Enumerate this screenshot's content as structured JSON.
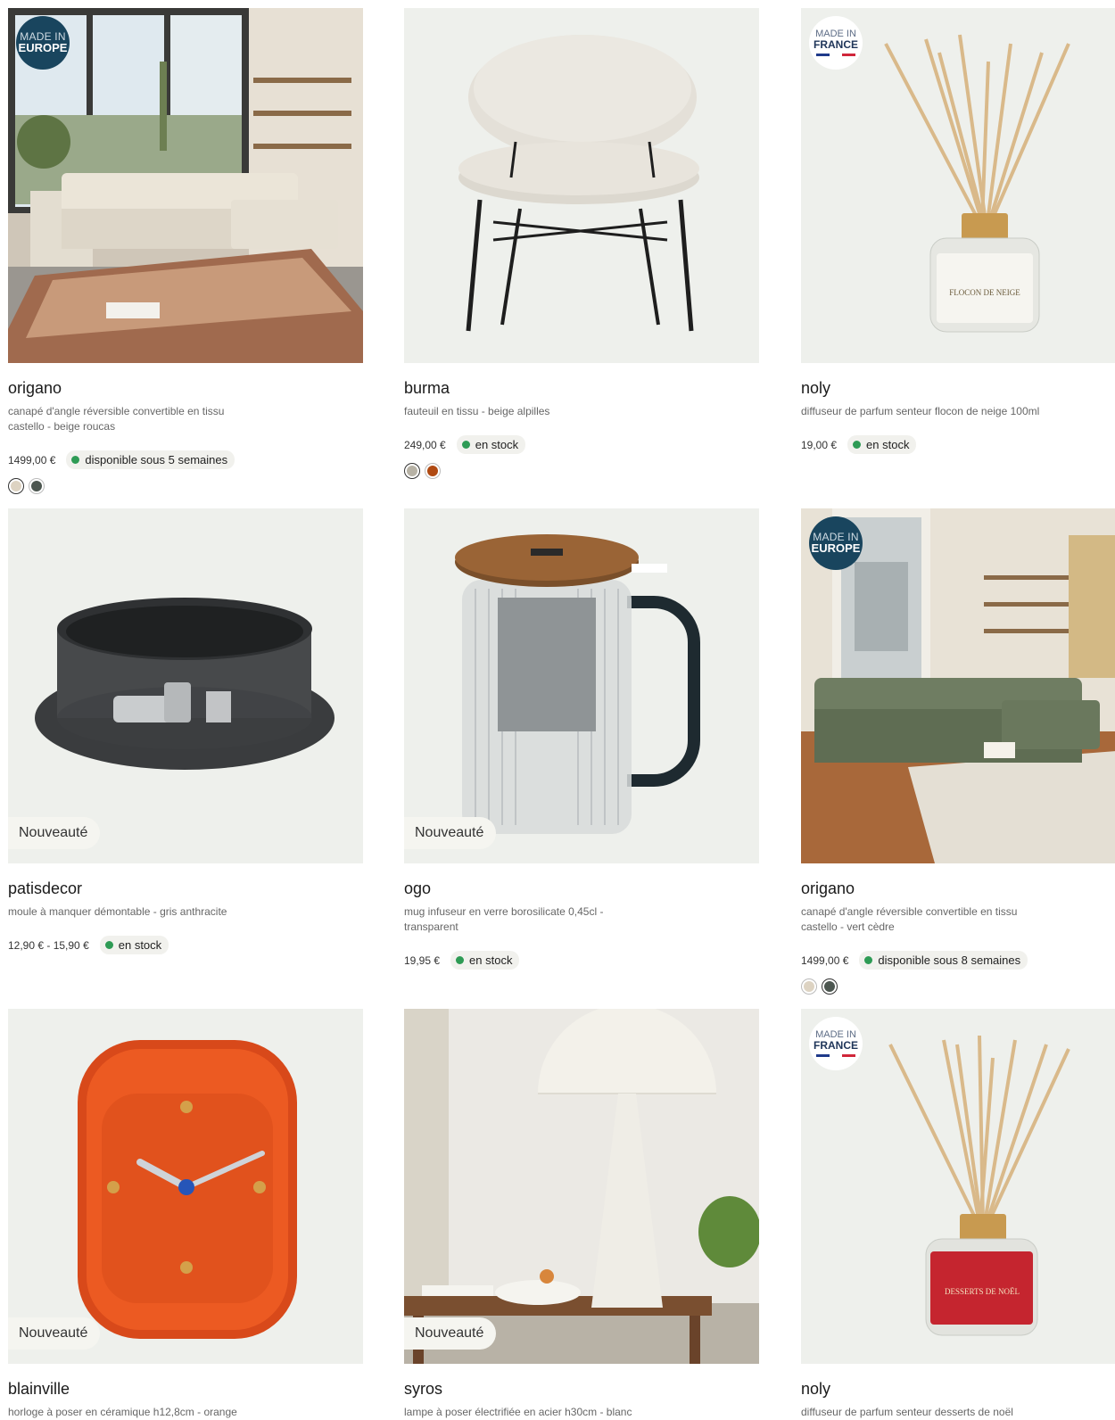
{
  "products": [
    {
      "title": "origano",
      "desc": "canapé d'angle réversible convertible en tissu castello - beige roucas",
      "price": "1499,00 €",
      "stock": "disponible sous 5 semaines",
      "badge": "MADE IN EUROPE",
      "badge_l1": "MADE IN",
      "badge_l2": "EUROPE",
      "swatches": [
        "#ddd3c2",
        "#4c5650"
      ],
      "icon": "sofa-beige-photo"
    },
    {
      "title": "burma",
      "desc": "fauteuil en tissu - beige alpilles",
      "price": "249,00 €",
      "stock": "en stock",
      "swatches": [
        "#b7b2a5",
        "#b04a12"
      ],
      "icon": "armchair-photo"
    },
    {
      "title": "noly",
      "desc": "diffuseur de parfum senteur flocon de neige 100ml",
      "price": "19,00 €",
      "stock": "en stock",
      "badge_l1": "MADE IN",
      "badge_l2": "FRANCE",
      "label_text": "FLOCON DE NEIGE",
      "icon": "diffuser-photo"
    },
    {
      "title": "patisdecor",
      "desc": "moule à manquer démontable - gris anthracite",
      "price": "12,90 € - 15,90 €",
      "stock": "en stock",
      "nouveaute": "Nouveauté",
      "icon": "cake-pan-photo"
    },
    {
      "title": "ogo",
      "desc": "mug infuseur en verre borosilicate 0,45cl - transparent",
      "price": "19,95 €",
      "stock": "en stock",
      "nouveaute": "Nouveauté",
      "icon": "mug-photo"
    },
    {
      "title": "origano",
      "desc": "canapé d'angle réversible convertible en tissu castello - vert cèdre",
      "price": "1499,00 €",
      "stock": "disponible sous 8 semaines",
      "badge_l1": "MADE IN",
      "badge_l2": "EUROPE",
      "swatches": [
        "#ddd3c2",
        "#4c5650"
      ],
      "icon": "sofa-green-photo"
    },
    {
      "title": "blainville",
      "desc": "horloge à poser en céramique h12,8cm - orange",
      "nouveaute": "Nouveauté",
      "icon": "clock-photo"
    },
    {
      "title": "syros",
      "desc": "lampe à poser électrifiée en acier h30cm - blanc",
      "nouveaute": "Nouveauté",
      "icon": "lamp-photo"
    },
    {
      "title": "noly",
      "desc": "diffuseur de parfum senteur desserts de noël",
      "badge_l1": "MADE IN",
      "badge_l2": "FRANCE",
      "label_text": "DESSERTS DE NOËL",
      "icon": "diffuser-red-photo"
    }
  ],
  "colors": {
    "stock_dot": "#2e9b55",
    "badge_eu": "#19455e",
    "image_bg": "#eef0ec"
  }
}
